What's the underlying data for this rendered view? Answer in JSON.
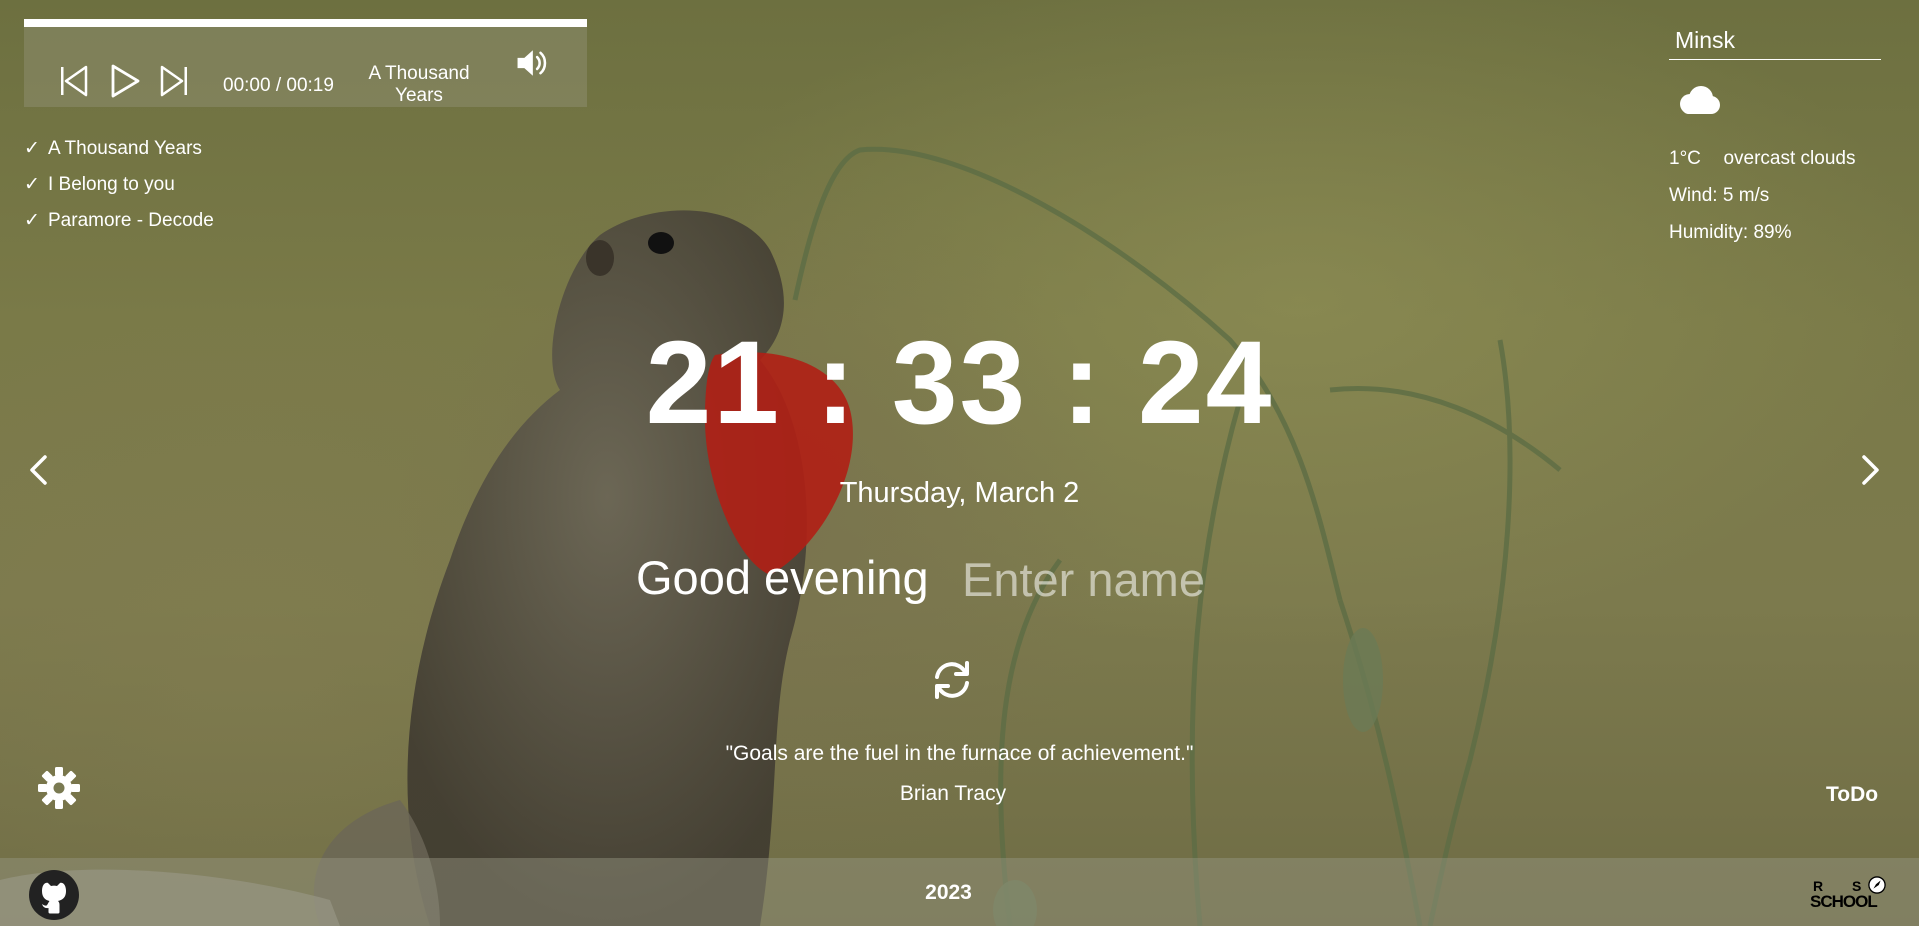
{
  "player": {
    "time": "00:00 / 00:19",
    "track_title": "A Thousand Years",
    "icons": [
      "prev-icon",
      "play-icon",
      "next-icon",
      "volume-icon"
    ]
  },
  "playlist": [
    {
      "check": "✓",
      "label": "A Thousand Years"
    },
    {
      "check": "✓",
      "label": "I Belong to you"
    },
    {
      "check": "✓",
      "label": "Paramore - Decode"
    }
  ],
  "weather": {
    "city": "Minsk",
    "icon": "cloud-icon",
    "temperature": "1°C",
    "description": "overcast clouds",
    "wind": "Wind: 5 m/s",
    "humidity": "Humidity: 89%"
  },
  "clock": {
    "time": "21 : 33 : 24",
    "date": "Thursday, March 2"
  },
  "greeting": {
    "text": "Good evening",
    "name_placeholder": "Enter name"
  },
  "quote": {
    "text": "\"Goals are the fuel in the furnace of achievement.\"",
    "author": "Brian Tracy"
  },
  "todo_label": "ToDo",
  "footer": {
    "year": "2023",
    "logo_text": "RS SCHOOL"
  }
}
